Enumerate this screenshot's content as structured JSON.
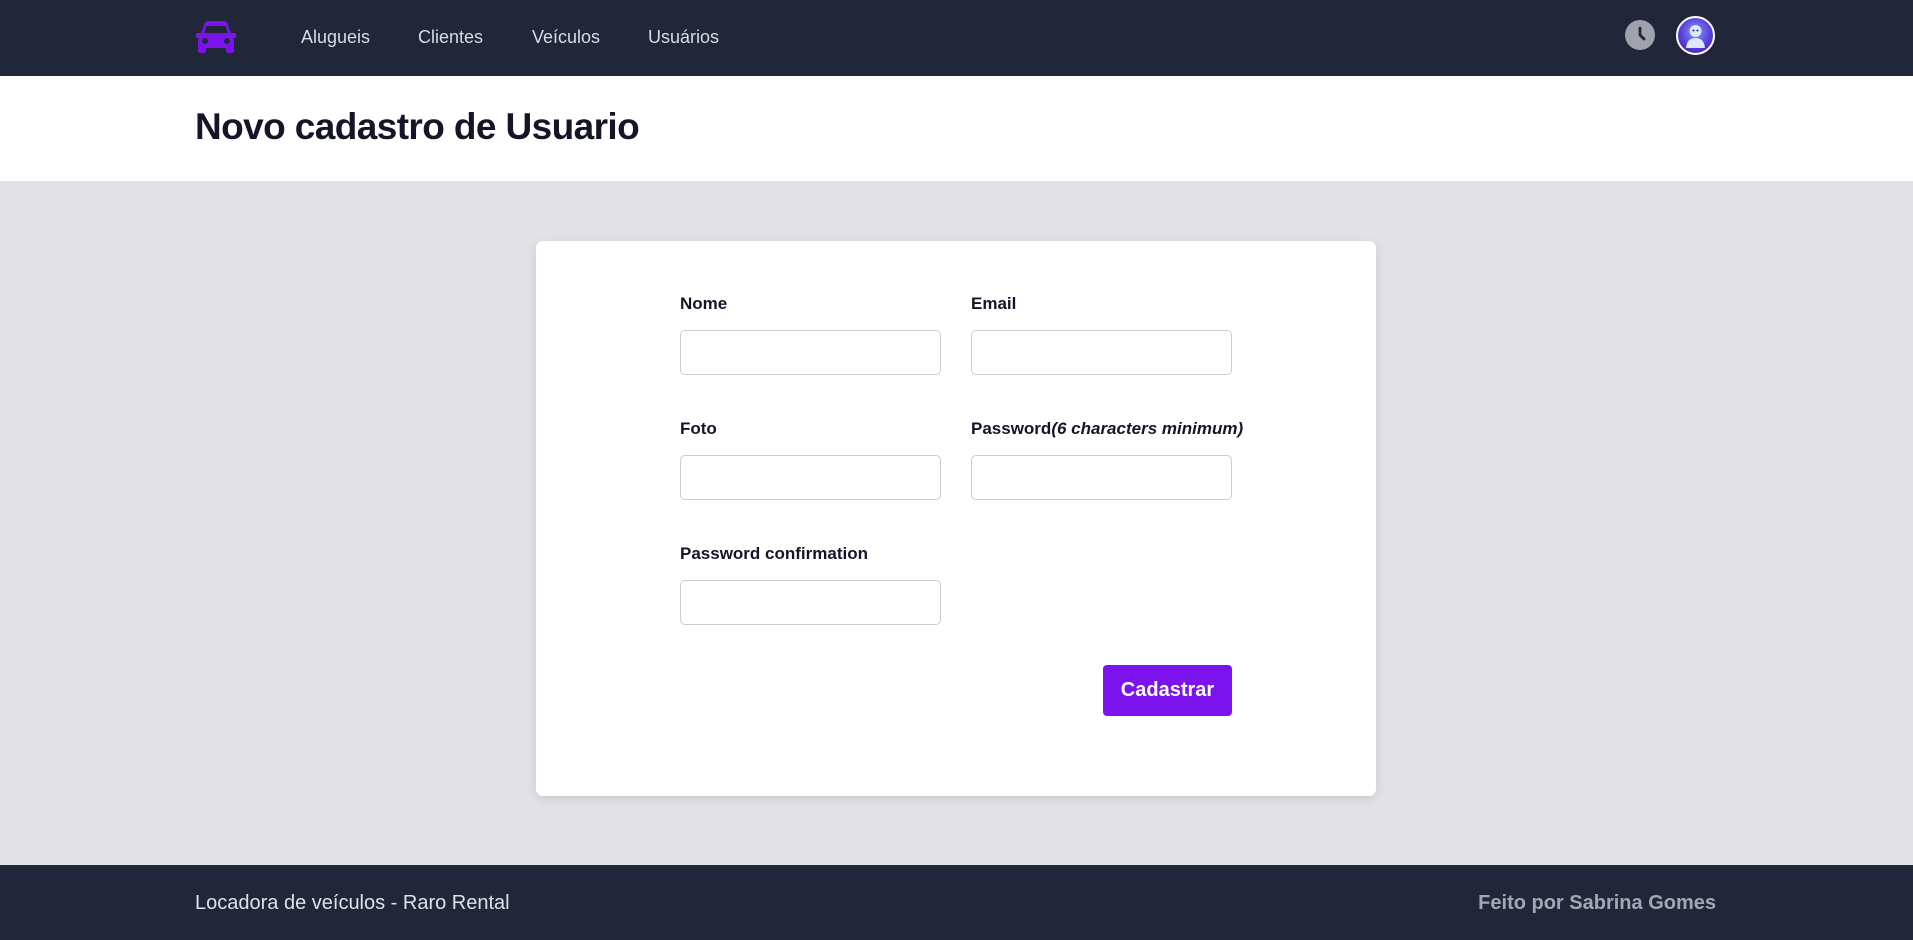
{
  "nav": {
    "logo_icon": "car-icon",
    "items": [
      {
        "label": "Alugueis"
      },
      {
        "label": "Clientes"
      },
      {
        "label": "Veículos"
      },
      {
        "label": "Usuários"
      }
    ],
    "history_icon": "clock-icon",
    "avatar_icon": "user-avatar"
  },
  "header": {
    "title": "Novo cadastro de Usuario"
  },
  "form": {
    "nome": {
      "label": "Nome",
      "value": "",
      "placeholder": ""
    },
    "email": {
      "label": "Email",
      "value": "",
      "placeholder": ""
    },
    "foto": {
      "label": "Foto",
      "value": "",
      "placeholder": ""
    },
    "password": {
      "label": "Password",
      "hint": "(6 characters minimum)",
      "value": "",
      "placeholder": ""
    },
    "password_confirmation": {
      "label": "Password confirmation",
      "value": "",
      "placeholder": ""
    },
    "submit_label": "Cadastrar"
  },
  "footer": {
    "left_text": "Locadora de veículos - Raro Rental",
    "right_text": "Feito por Sabrina Gomes"
  },
  "colors": {
    "navbar_bg": "#212738",
    "accent": "#7a13ec",
    "page_bg": "#e2e1e6",
    "card_bg": "#ffffff",
    "title_text": "#141527"
  }
}
